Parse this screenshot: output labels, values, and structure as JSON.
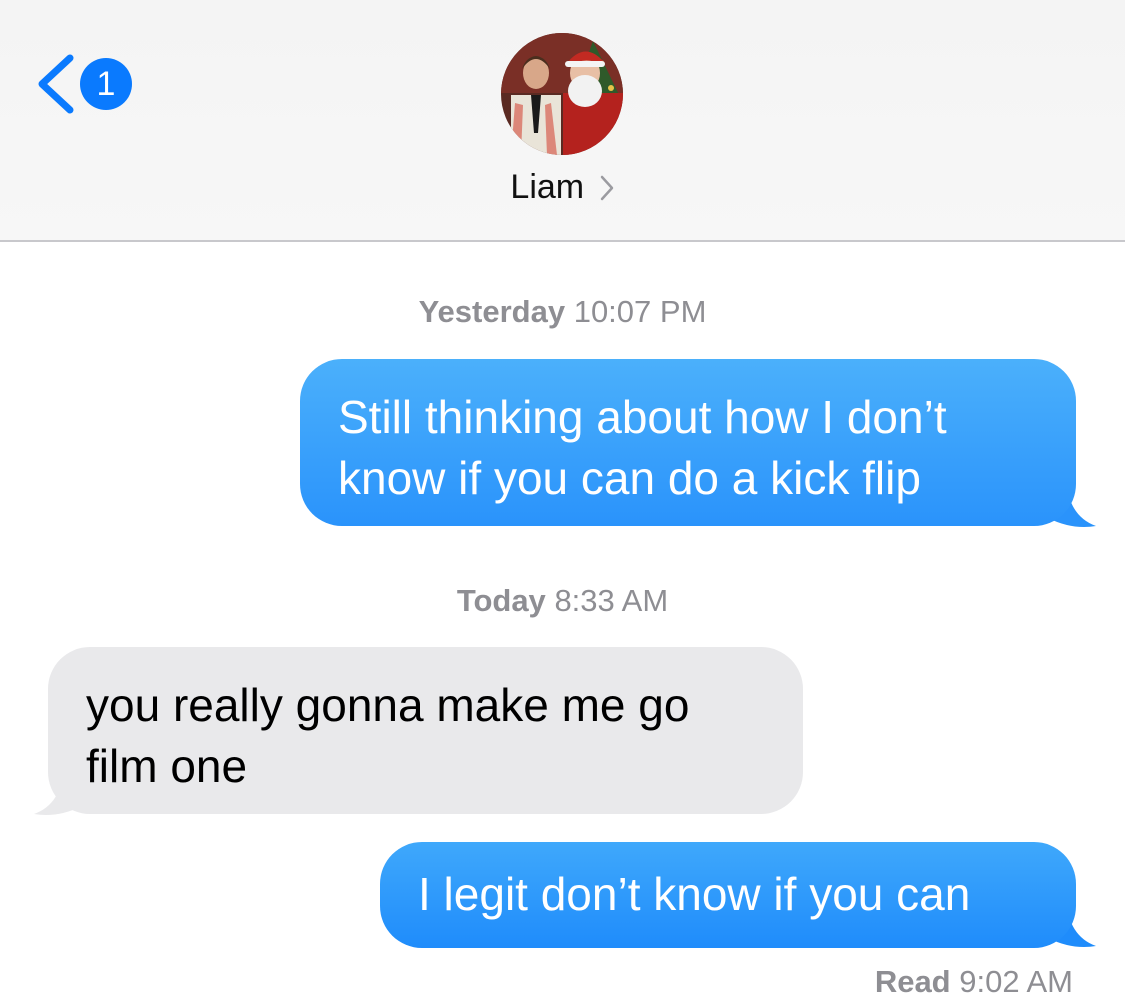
{
  "header": {
    "back_badge_count": "1",
    "contact_name": "Liam"
  },
  "messages": [
    {
      "timestamp_day": "Yesterday",
      "timestamp_time": "10:07 PM",
      "direction": "outgoing",
      "lines": [
        "Still thinking about how I don’t",
        "know if you can do a kick flip"
      ]
    },
    {
      "timestamp_day": "Today",
      "timestamp_time": "8:33 AM",
      "direction": "incoming",
      "lines": [
        "you really gonna make me go",
        "film one"
      ]
    },
    {
      "direction": "outgoing",
      "lines": [
        "I legit don’t know if you can"
      ]
    }
  ],
  "read_receipt": {
    "label": "Read",
    "time": "9:02 AM"
  },
  "colors": {
    "accent": "#0a7afe",
    "outgoing_bubble_top": "#4bb2fb",
    "outgoing_bubble_bottom": "#1f8cfb",
    "incoming_bubble": "#e9e9eb",
    "timestamp_text": "#8e8e93"
  },
  "icons": {
    "back": "chevron-left-icon",
    "contact_details": "chevron-right-icon"
  }
}
